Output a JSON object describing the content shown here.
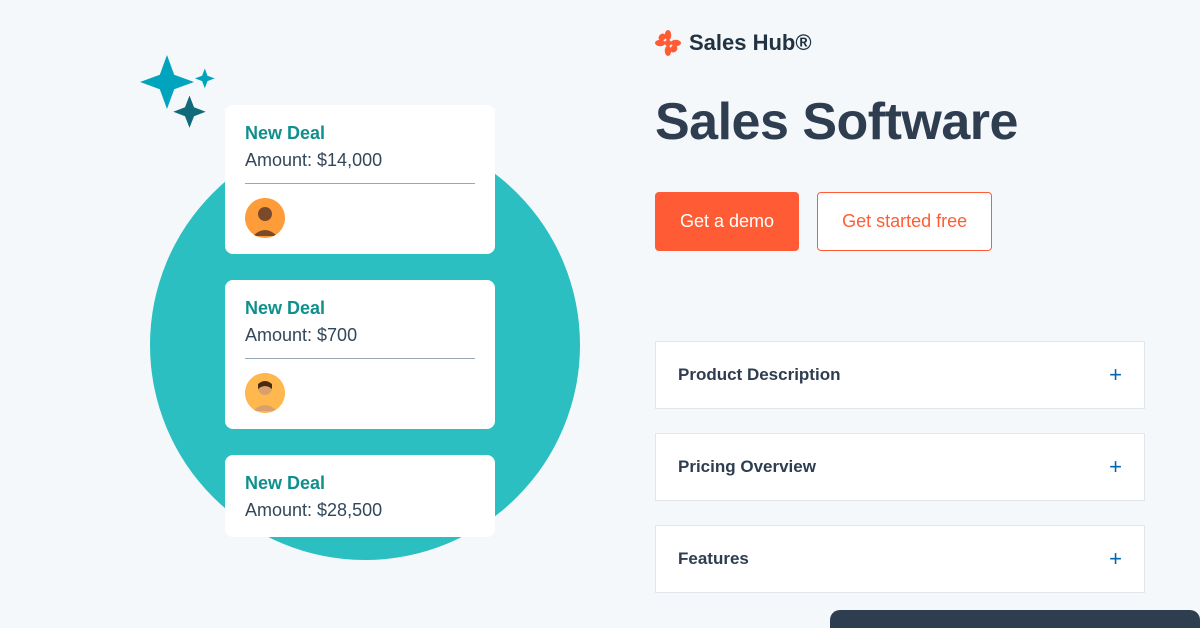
{
  "brand": {
    "name": "Sales Hub®"
  },
  "hero": {
    "title": "Sales Software"
  },
  "cta": {
    "primary": "Get a demo",
    "secondary": "Get started free"
  },
  "accordion": [
    {
      "label": "Product Description"
    },
    {
      "label": "Pricing Overview"
    },
    {
      "label": "Features"
    }
  ],
  "deals": [
    {
      "title": "New Deal",
      "amount_label": "Amount: $14,000"
    },
    {
      "title": "New Deal",
      "amount_label": "Amount: $700"
    },
    {
      "title": "New Deal",
      "amount_label": "Amount: $28,500"
    }
  ]
}
